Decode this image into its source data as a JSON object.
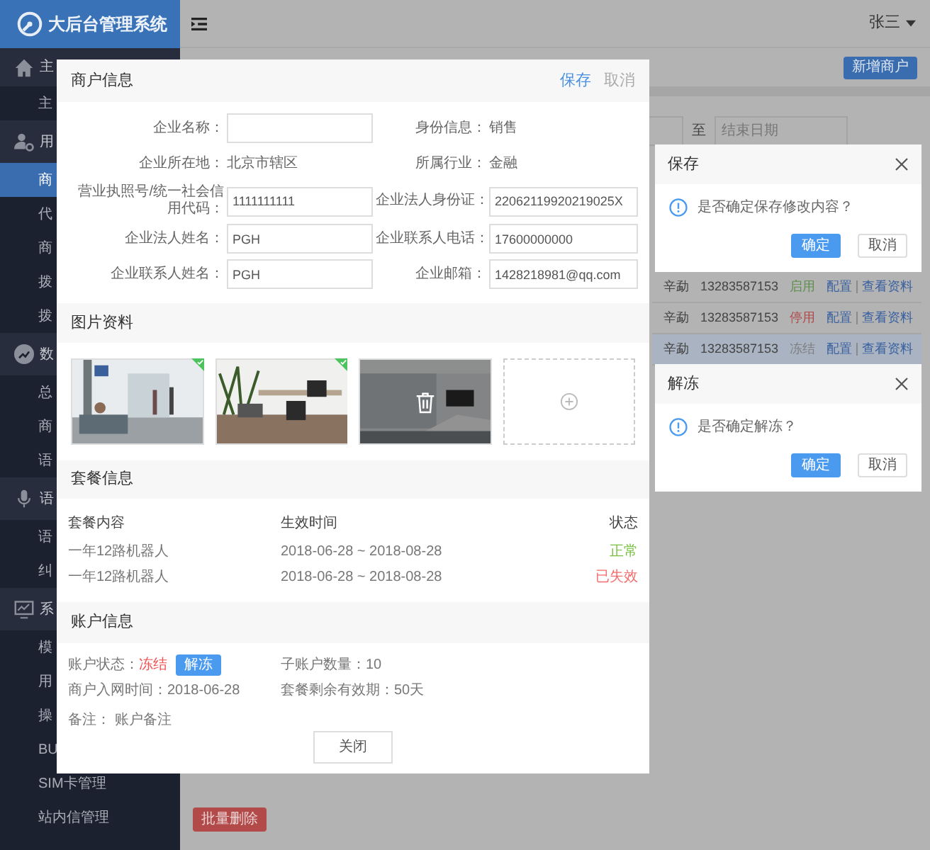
{
  "app": {
    "title": "大后台管理系统",
    "user": "张三"
  },
  "sidebar": [
    {
      "label": "主",
      "items": [
        {
          "label": "主",
          "selected": false
        }
      ]
    },
    {
      "label": "用",
      "items": [
        {
          "label": "商",
          "selected": true
        },
        {
          "label": "代",
          "selected": false
        },
        {
          "label": "商",
          "selected": false
        },
        {
          "label": "拨",
          "selected": false
        },
        {
          "label": "拨",
          "selected": false
        }
      ]
    },
    {
      "label": "数",
      "items": [
        {
          "label": "总",
          "selected": false
        },
        {
          "label": "商",
          "selected": false
        },
        {
          "label": "语",
          "selected": false
        }
      ]
    },
    {
      "label": "语",
      "items": [
        {
          "label": "语",
          "selected": false
        },
        {
          "label": "纠",
          "selected": false
        }
      ]
    },
    {
      "label": "系",
      "items": [
        {
          "label": "模",
          "selected": false
        },
        {
          "label": "用",
          "selected": false
        },
        {
          "label": "操",
          "selected": false
        },
        {
          "label": "BU",
          "selected": false
        },
        {
          "label": "SIM卡管理",
          "selected": false
        },
        {
          "label": "站内信管理",
          "selected": false
        }
      ]
    }
  ],
  "toolbar": {
    "add_button": "新增商户"
  },
  "filter": {
    "separator": "至",
    "end_date_placeholder": "结束日期"
  },
  "table_rows": [
    {
      "column_1": "辛勐",
      "column_2": "13283587153",
      "status": "启用",
      "color": "#5e8f4c",
      "actions": [
        "配置",
        "查看资料"
      ],
      "selected": false
    },
    {
      "column_1": "辛勐",
      "column_2": "13283587153",
      "status": "停用",
      "color": "#b04a4a",
      "actions": [
        "配置",
        "查看资料"
      ],
      "selected": false
    },
    {
      "column_1": "辛勐",
      "column_2": "13283587153",
      "status": "冻结",
      "color": "#808080",
      "actions": [
        "配置",
        "查看资料"
      ],
      "selected": true
    }
  ],
  "bulk_delete_button": "批量删除",
  "merchant_modal": {
    "title": "商户信息",
    "save": "保存",
    "cancel": "取消",
    "fields": [
      {
        "label": "企业名称：",
        "kind": "input"
      },
      {
        "label": "身份信息：",
        "kind": "text",
        "value": "销售"
      },
      {
        "label": "企业所在地：",
        "kind": "text",
        "value": "北京市辖区"
      },
      {
        "label": "所属行业：",
        "kind": "text",
        "value": "金融"
      },
      {
        "label": "营业执照号/统一社会信用代码：",
        "kind": "input",
        "value": "1111111111"
      },
      {
        "label": "企业法人身份证：",
        "kind": "input",
        "value": "22062119920219025X"
      },
      {
        "label": "企业法人姓名：",
        "kind": "input",
        "value": "PGH"
      },
      {
        "label": "企业联系人电话：",
        "kind": "input",
        "value": "17600000000"
      },
      {
        "label": "企业联系人姓名：",
        "kind": "input",
        "value": "PGH"
      },
      {
        "label": "企业邮箱：",
        "kind": "input",
        "value": "1428218981@qq.com"
      }
    ],
    "photos_title": "图片资料",
    "photos": [
      {
        "kind": "picture",
        "verified": true,
        "delete_overlay": false
      },
      {
        "kind": "picture",
        "verified": true,
        "delete_overlay": false
      },
      {
        "kind": "picture",
        "verified": false,
        "delete_overlay": true
      },
      {
        "kind": "upload"
      }
    ],
    "package_title": "套餐信息",
    "package_columns": [
      "套餐内容",
      "生效时间",
      "状态"
    ],
    "packages": [
      {
        "content": "一年12路机器人",
        "period": "2018-06-28 ~ 2018-08-28",
        "status": "正常",
        "color": "#7ac143"
      },
      {
        "content": "一年12路机器人",
        "period": "2018-06-28 ~ 2018-08-28",
        "status": "已失效",
        "color": "#f56c6c"
      }
    ],
    "account_title": "账户信息",
    "account": {
      "status_label": "账户状态：",
      "status": "冻结",
      "frozen": true,
      "unfreeze_button": "解冻",
      "sub_accounts": "子账户数量：10",
      "joined": "商户入网时间：2018-06-28",
      "remaining": "套餐剩余有效期：50天",
      "note": "备注： 账户备注"
    },
    "close_button": "关闭"
  },
  "dialogs": [
    {
      "title": "保存",
      "message": "是否确定保存修改内容？",
      "confirm": "确定",
      "cancel": "取消"
    },
    {
      "title": "解冻",
      "message": "是否确定解冻？",
      "confirm": "确定",
      "cancel": "取消"
    }
  ]
}
